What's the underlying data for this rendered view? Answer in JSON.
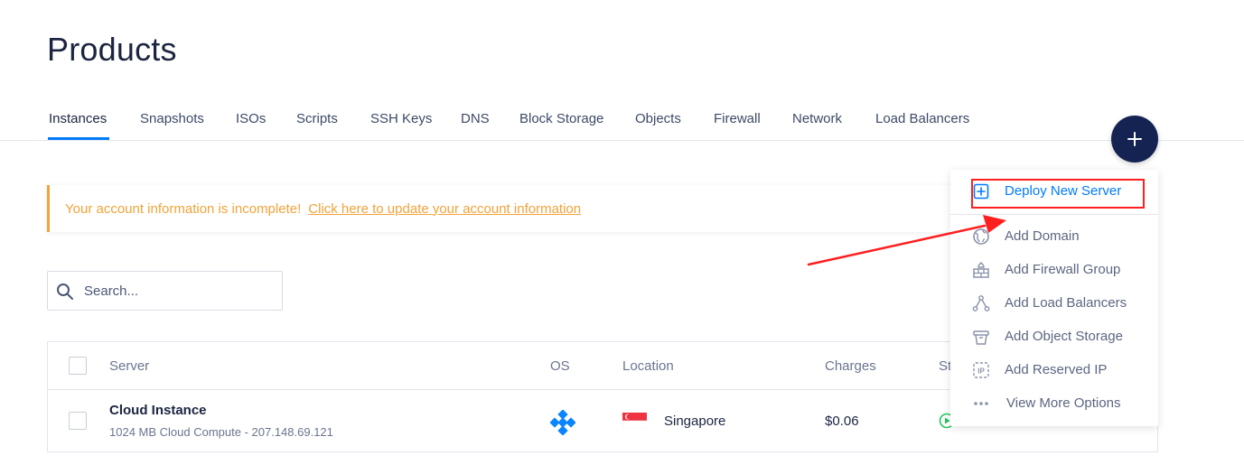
{
  "page": {
    "title": "Products"
  },
  "tabs": [
    {
      "label": "Instances",
      "active": true
    },
    {
      "label": "Snapshots"
    },
    {
      "label": "ISOs"
    },
    {
      "label": "Scripts"
    },
    {
      "label": "SSH Keys"
    },
    {
      "label": "DNS"
    },
    {
      "label": "Block Storage"
    },
    {
      "label": "Objects"
    },
    {
      "label": "Firewall"
    },
    {
      "label": "Network"
    },
    {
      "label": "Load Balancers"
    }
  ],
  "fab": {
    "icon": "plus-icon"
  },
  "alert": {
    "message": "Your account information is incomplete!",
    "link": "Click here to update your account information",
    "color": "#f2a33a"
  },
  "search": {
    "placeholder": "Search...",
    "value": ""
  },
  "table": {
    "headers": {
      "server": "Server",
      "os": "OS",
      "location": "Location",
      "charges": "Charges",
      "status": "St"
    },
    "rows": [
      {
        "server": "Cloud Instance",
        "description": "1024 MB Cloud Compute - 207.148.69.121",
        "os_icon": "os-logo-icon",
        "location_flag": "singapore-flag-icon",
        "location": "Singapore",
        "charges": "$0.06",
        "status_icon": "running-status-icon"
      }
    ]
  },
  "menu": {
    "items": [
      {
        "label": "Deploy New Server",
        "icon": "plus-square-icon",
        "primary": true
      },
      {
        "label": "Add Domain",
        "icon": "globe-icon"
      },
      {
        "label": "Add Firewall Group",
        "icon": "firewall-icon"
      },
      {
        "label": "Add Load Balancers",
        "icon": "load-balancer-icon"
      },
      {
        "label": "Add Object Storage",
        "icon": "object-storage-icon"
      },
      {
        "label": "Add Reserved IP",
        "icon": "reserved-ip-icon"
      },
      {
        "label": "View More Options",
        "icon": "more-options-icon"
      }
    ]
  },
  "colors": {
    "accent": "#007bfc",
    "fab": "#142352",
    "annotation": "#ff1f1f",
    "status_running": "#22c55e"
  }
}
